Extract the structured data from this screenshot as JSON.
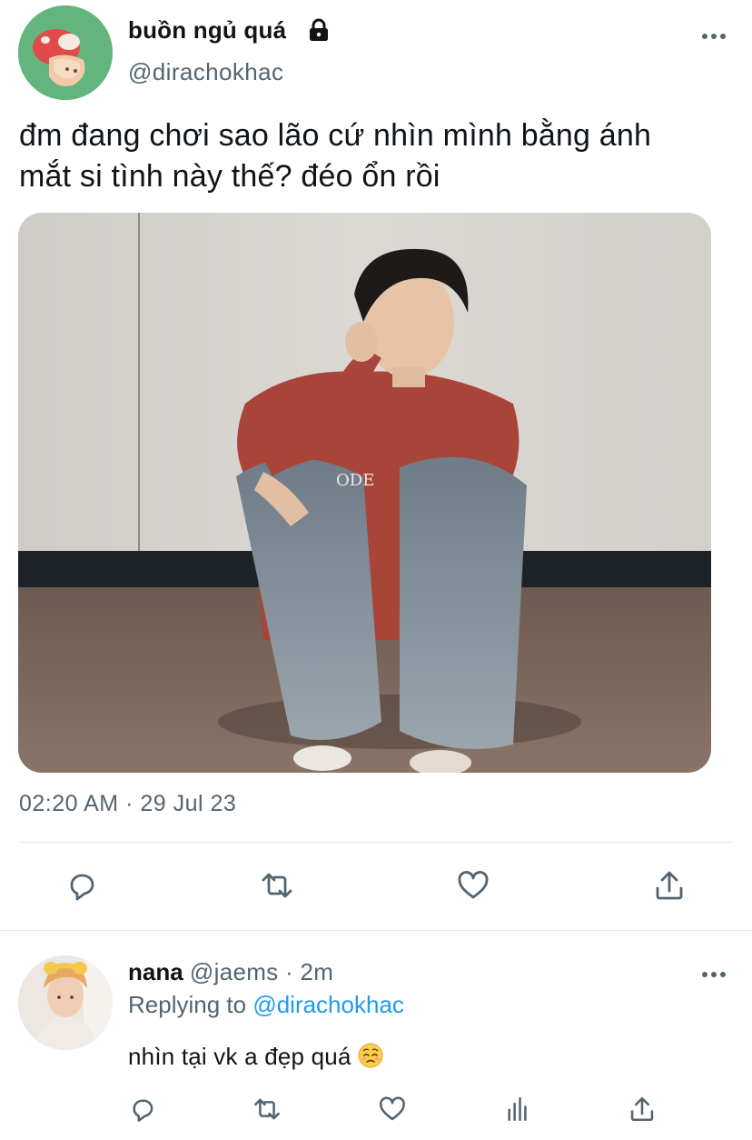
{
  "tweet": {
    "author_name": "buồn ngủ quá",
    "author_handle": "@dirachokhac",
    "text_line1": "đm đang chơi sao lão cứ nhìn mình bằng ánh",
    "text_line2": "mắt si tình này thế? đéo ổn rồi",
    "timestamp": "02:20 AM · 29 Jul 23",
    "icons": {
      "lock": "lock-icon",
      "more": "more-icon",
      "reply": "reply-icon",
      "retweet": "retweet-icon",
      "like": "like-icon",
      "share": "share-icon"
    }
  },
  "reply": {
    "name": "nana",
    "meta": "@jaems · 2m",
    "replying_prefix": "Replying to",
    "replying_handle": "@dirachokhac",
    "text": "nhìn tại vk a đẹp quá",
    "emoji": "pleading-face-emoji",
    "icons": {
      "reply": "reply-icon",
      "retweet": "retweet-icon",
      "like": "like-icon",
      "analytics": "analytics-icon",
      "share": "share-icon",
      "more": "more-icon"
    }
  },
  "colors": {
    "text": "#0f1419",
    "secondary": "#536471",
    "accent": "#1d9bf0",
    "divider": "#e6e9ec"
  }
}
